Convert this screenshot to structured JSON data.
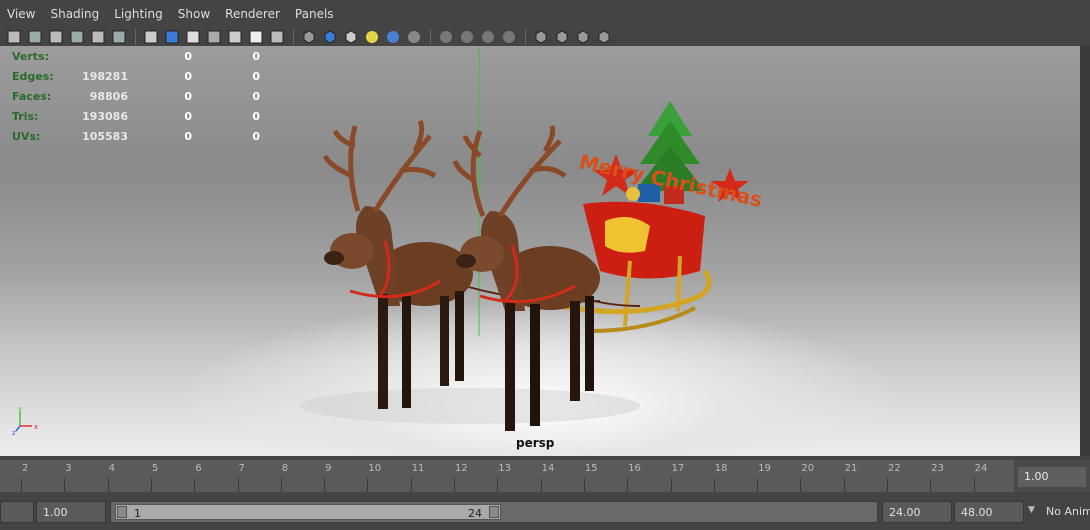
{
  "menu": [
    "View",
    "Shading",
    "Lighting",
    "Show",
    "Renderer",
    "Panels"
  ],
  "toolbar_icons": [
    "camera-attributes-icon",
    "bookmark-icon",
    "image-plane-icon",
    "grid-icon",
    "film-gate-icon",
    "safe-action-icon",
    "wireframe-icon",
    "smooth-shade-icon",
    "flat-shade-icon",
    "bounding-box-icon",
    "points-icon",
    "textured-icon",
    "use-lights-icon",
    "cube-wire-icon",
    "cube-shaded-icon",
    "cube-textured-icon",
    "all-lights-icon",
    "shadows-icon",
    "ssao-icon",
    "motion-blur-icon",
    "anti-alias-icon",
    "depth-of-field-icon",
    "xray-icon",
    "isolate-select-icon",
    "xray-joints-icon",
    "xray-active-icon",
    "multi-sample-icon"
  ],
  "hud": [
    {
      "label": "Verts:",
      "v1": "",
      "v2": "0",
      "v3": "0"
    },
    {
      "label": "Edges:",
      "v1": "198281",
      "v2": "0",
      "v3": "0"
    },
    {
      "label": "Faces:",
      "v1": "98806",
      "v2": "0",
      "v3": "0"
    },
    {
      "label": "Tris:",
      "v1": "193086",
      "v2": "0",
      "v3": "0"
    },
    {
      "label": "UVs:",
      "v1": "105583",
      "v2": "0",
      "v3": "0"
    }
  ],
  "camera_label": "persp",
  "axis": {
    "x": "x",
    "y": "y",
    "z": "z"
  },
  "scene_text": "Merry Christmas",
  "timeline": {
    "ticks": [
      "2",
      "3",
      "4",
      "5",
      "6",
      "7",
      "8",
      "9",
      "10",
      "11",
      "12",
      "13",
      "14",
      "15",
      "16",
      "17",
      "18",
      "19",
      "20",
      "21",
      "22",
      "23",
      "24"
    ],
    "current_frame": "1.00"
  },
  "range": {
    "start_field": "1.00",
    "inner_start": "1",
    "inner_end": "24",
    "end_field": "24.00",
    "anim_end": "48.00",
    "anim_layer": "No Anim"
  },
  "colors": {
    "hud_label": "#2a6b2a",
    "sled_red": "#d42a1a",
    "tree_green": "#2f8a2a"
  }
}
